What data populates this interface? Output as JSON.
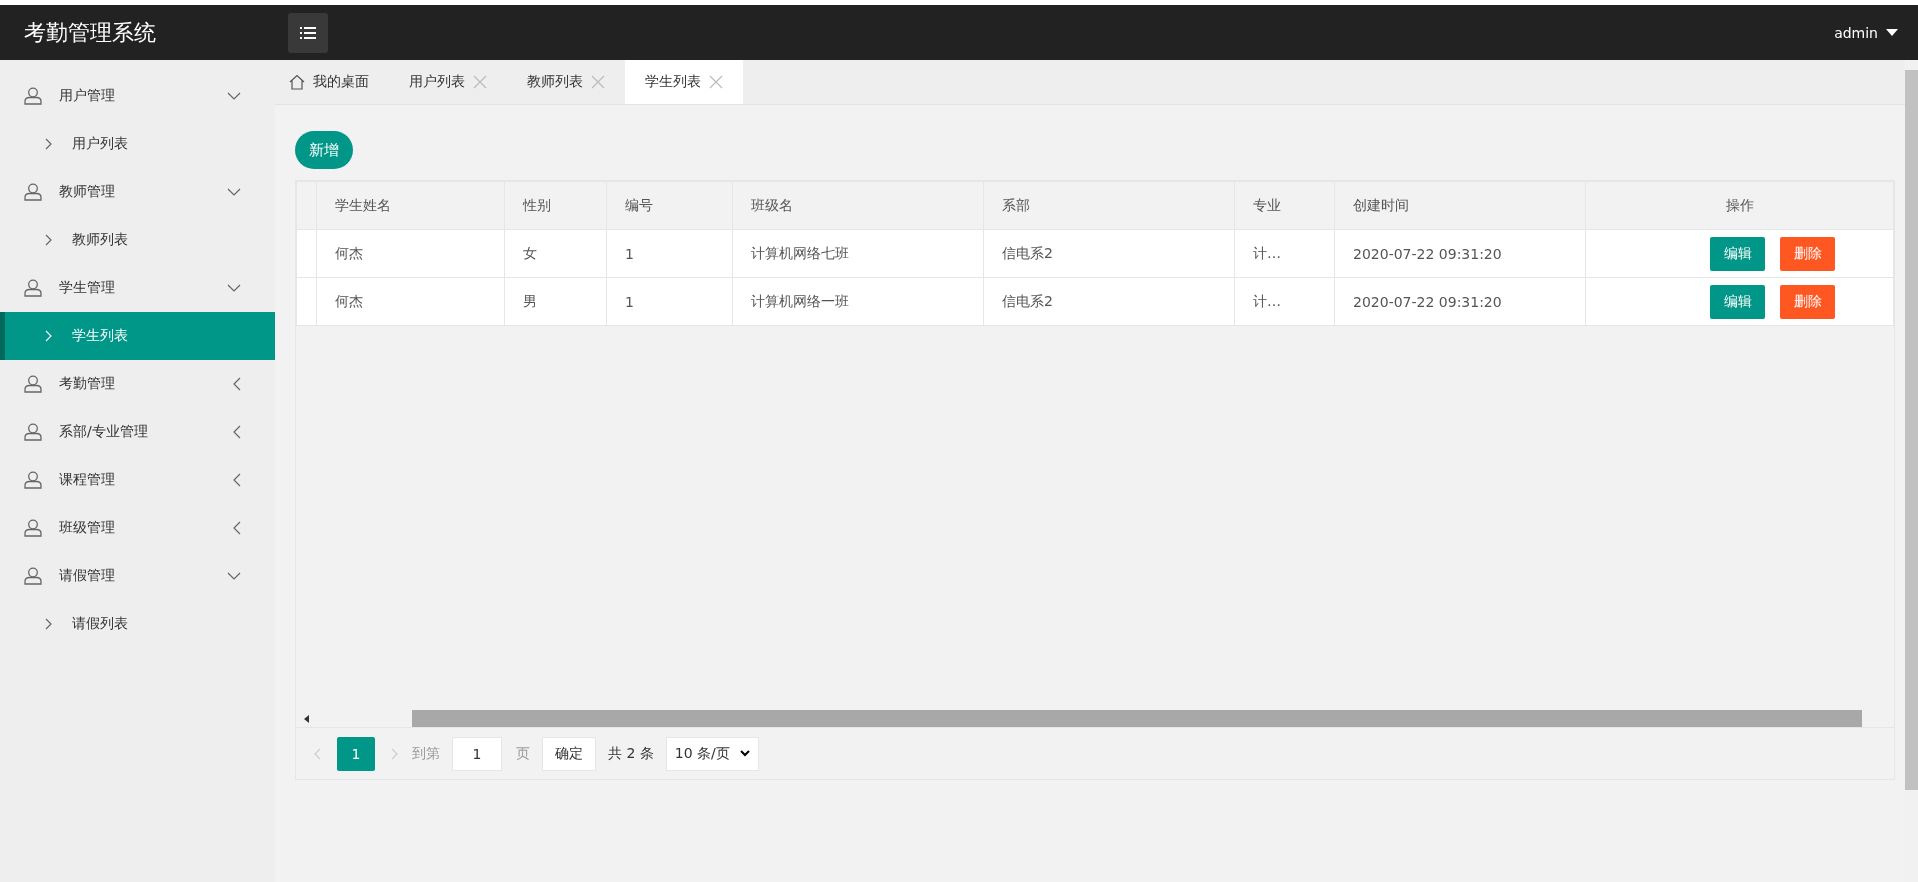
{
  "header": {
    "title": "考勤管理系统",
    "user": "admin"
  },
  "sidebar": {
    "groups": [
      {
        "label": "用户管理",
        "expanded": true,
        "children": [
          {
            "label": "用户列表",
            "selected": false
          }
        ]
      },
      {
        "label": "教师管理",
        "expanded": true,
        "children": [
          {
            "label": "教师列表",
            "selected": false
          }
        ]
      },
      {
        "label": "学生管理",
        "expanded": true,
        "children": [
          {
            "label": "学生列表",
            "selected": true
          }
        ]
      },
      {
        "label": "考勤管理",
        "expanded": false
      },
      {
        "label": "系部/专业管理",
        "expanded": false
      },
      {
        "label": "课程管理",
        "expanded": false
      },
      {
        "label": "班级管理",
        "expanded": false
      },
      {
        "label": "请假管理",
        "expanded": true,
        "children": [
          {
            "label": "请假列表",
            "selected": false
          }
        ]
      }
    ]
  },
  "tabs": [
    {
      "kind": "home",
      "label": "我的桌面",
      "selected": false
    },
    {
      "kind": "page",
      "label": "用户列表",
      "selected": false
    },
    {
      "kind": "page",
      "label": "教师列表",
      "selected": false
    },
    {
      "kind": "page",
      "label": "学生列表",
      "selected": true
    }
  ],
  "add_button": "新增",
  "table": {
    "columns": [
      "学生姓名",
      "性别",
      "编号",
      "班级名",
      "系部",
      "专业",
      "创建时间",
      "操作"
    ],
    "rows": [
      {
        "cells": [
          "何杰",
          "女",
          "1",
          "计算机网络七班",
          "信电系2",
          "计…",
          "2020-07-22 09:31:20"
        ],
        "actions": [
          {
            "kind": "edit",
            "label": "编辑"
          },
          {
            "kind": "delete",
            "label": "删除"
          }
        ]
      },
      {
        "cells": [
          "何杰",
          "男",
          "1",
          "计算机网络一班",
          "信电系2",
          "计…",
          "2020-07-22 09:31:20"
        ],
        "actions": [
          {
            "kind": "edit",
            "label": "编辑"
          },
          {
            "kind": "delete",
            "label": "删除"
          }
        ]
      }
    ]
  },
  "pagination": {
    "pages": [
      {
        "label": "1",
        "selected": true
      }
    ],
    "goto_label": "到第",
    "page_value": "1",
    "page_unit": "页",
    "confirm": "确定",
    "total": "共 2 条",
    "page_size": "10 条/页"
  }
}
